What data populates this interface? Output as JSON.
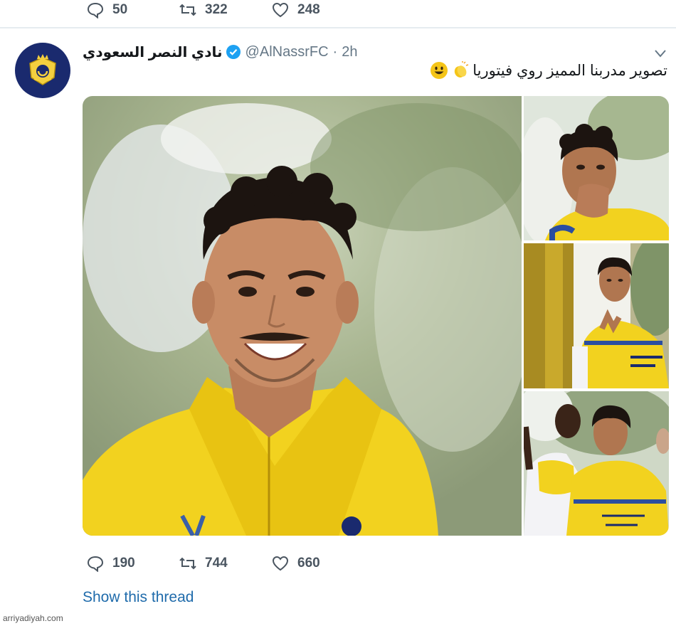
{
  "previous_tweet": {
    "replies": "50",
    "retweets": "322",
    "likes": "248"
  },
  "tweet": {
    "display_name": "نادي النصر السعودي",
    "handle": "@AlNassrFC",
    "separator": "·",
    "time": "2h",
    "text": "تصوير مدربنا المميز روي فيتوريا",
    "emojis": [
      "clapping-hands-emoji",
      "smiling-face-emoji"
    ],
    "replies": "190",
    "retweets": "744",
    "likes": "660",
    "show_thread": "Show this thread"
  },
  "photos": {
    "main_alt": "player smiling in yellow training jacket",
    "top_right_alt": "player blowing a kiss",
    "middle_right_alt": "player making a gesture in training kit",
    "bottom_right_alt": "two players at training"
  },
  "colors": {
    "accent": "#1f6bab",
    "verified": "#1da1f2",
    "club_navy": "#1a2a6e",
    "club_yellow": "#f4d03f"
  },
  "watermark": "arriyadiyah.com"
}
